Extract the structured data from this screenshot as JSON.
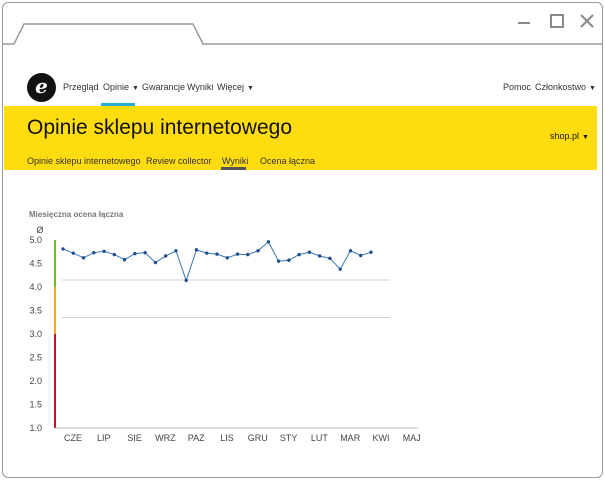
{
  "window": {
    "controls": [
      {
        "name": "minimize-button",
        "icon": "minimize-icon"
      },
      {
        "name": "maximize-button",
        "icon": "maximize-icon"
      },
      {
        "name": "close-button",
        "icon": "close-icon"
      }
    ]
  },
  "nav": {
    "logo_letter": "e",
    "items": [
      "Przegląd",
      "Opinie",
      "Gwarancje",
      "Wyniki",
      "Więcej"
    ],
    "active": "Opinie",
    "right": [
      "Pomoc",
      "Członkostwo"
    ]
  },
  "header": {
    "title": "Opinie sklepu internetowego",
    "shop": "shop.pl",
    "subtabs": [
      "Opinie sklepu internetowego",
      "Review collector",
      "Wyniki",
      "Ocena łączna"
    ],
    "active_subtab": "Wyniki"
  },
  "colors": {
    "accent_yellow": "#ffdc0f",
    "active_nav": "#27a9d6",
    "line": "#3a75b5",
    "point": "#1f4e8c",
    "zone_green": "#6cbf2a",
    "zone_orange": "#f5a623",
    "zone_red": "#c8102e"
  },
  "chart_data": {
    "type": "line",
    "title": "Miesięczna ocena łączna",
    "avg_symbol": "Ø",
    "ylim": [
      1.0,
      5.0
    ],
    "yticks": [
      "5.0",
      "4.5",
      "4.0",
      "3.5",
      "3.0",
      "2.5",
      "2.0",
      "1.5",
      "1.0"
    ],
    "months": [
      "CZE",
      "LIP",
      "SIE",
      "WRZ",
      "PAZ",
      "LIS",
      "GRU",
      "STY",
      "LUT",
      "MAR",
      "KWI",
      "MAJ"
    ],
    "gridlines": [
      4.15,
      3.35
    ],
    "zones": [
      {
        "from": 4.0,
        "to": 5.0,
        "color": "zone_green"
      },
      {
        "from": 3.0,
        "to": 4.0,
        "color": "zone_orange"
      },
      {
        "from": 1.0,
        "to": 3.0,
        "color": "zone_red"
      }
    ],
    "series": [
      {
        "values": [
          4.81,
          4.72,
          4.62,
          4.73,
          4.76,
          4.69,
          4.58,
          4.71,
          4.73,
          4.52,
          4.66,
          4.77,
          4.14,
          4.79,
          4.72,
          4.7,
          4.62,
          4.7,
          4.69,
          4.77,
          4.96,
          4.55,
          4.57,
          4.69,
          4.74,
          4.66,
          4.61,
          4.38,
          4.77,
          4.67,
          4.74
        ]
      }
    ]
  }
}
